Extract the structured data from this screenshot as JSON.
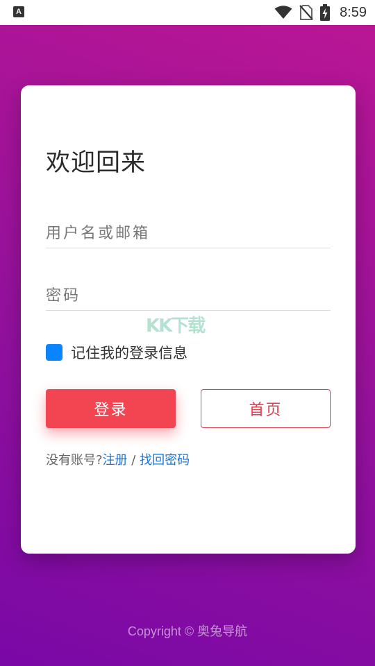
{
  "status_bar": {
    "left_icon_letter": "A",
    "time": "8:59",
    "icons": [
      "wifi-icon",
      "no-sim-icon",
      "battery-charging-icon"
    ]
  },
  "colors": {
    "gradient_start": "#7a08a6",
    "gradient_end": "#b91694",
    "login_button": "#f24451",
    "home_button_border": "#e43c4c",
    "checkbox": "#0a84ff",
    "link": "#1777d6"
  },
  "card": {
    "title": "欢迎回来",
    "username_placeholder": "用户名或邮箱",
    "password_placeholder": "密码",
    "remember_label": "记住我的登录信息",
    "remember_checked": true,
    "login_button": "登录",
    "home_button": "首页",
    "no_account_text": "没有账号?",
    "register_link": "注册",
    "separator": "/",
    "recover_link": "找回密码"
  },
  "watermark": "KK下载",
  "footer": {
    "copyright": "Copyright © 奥兔导航"
  }
}
